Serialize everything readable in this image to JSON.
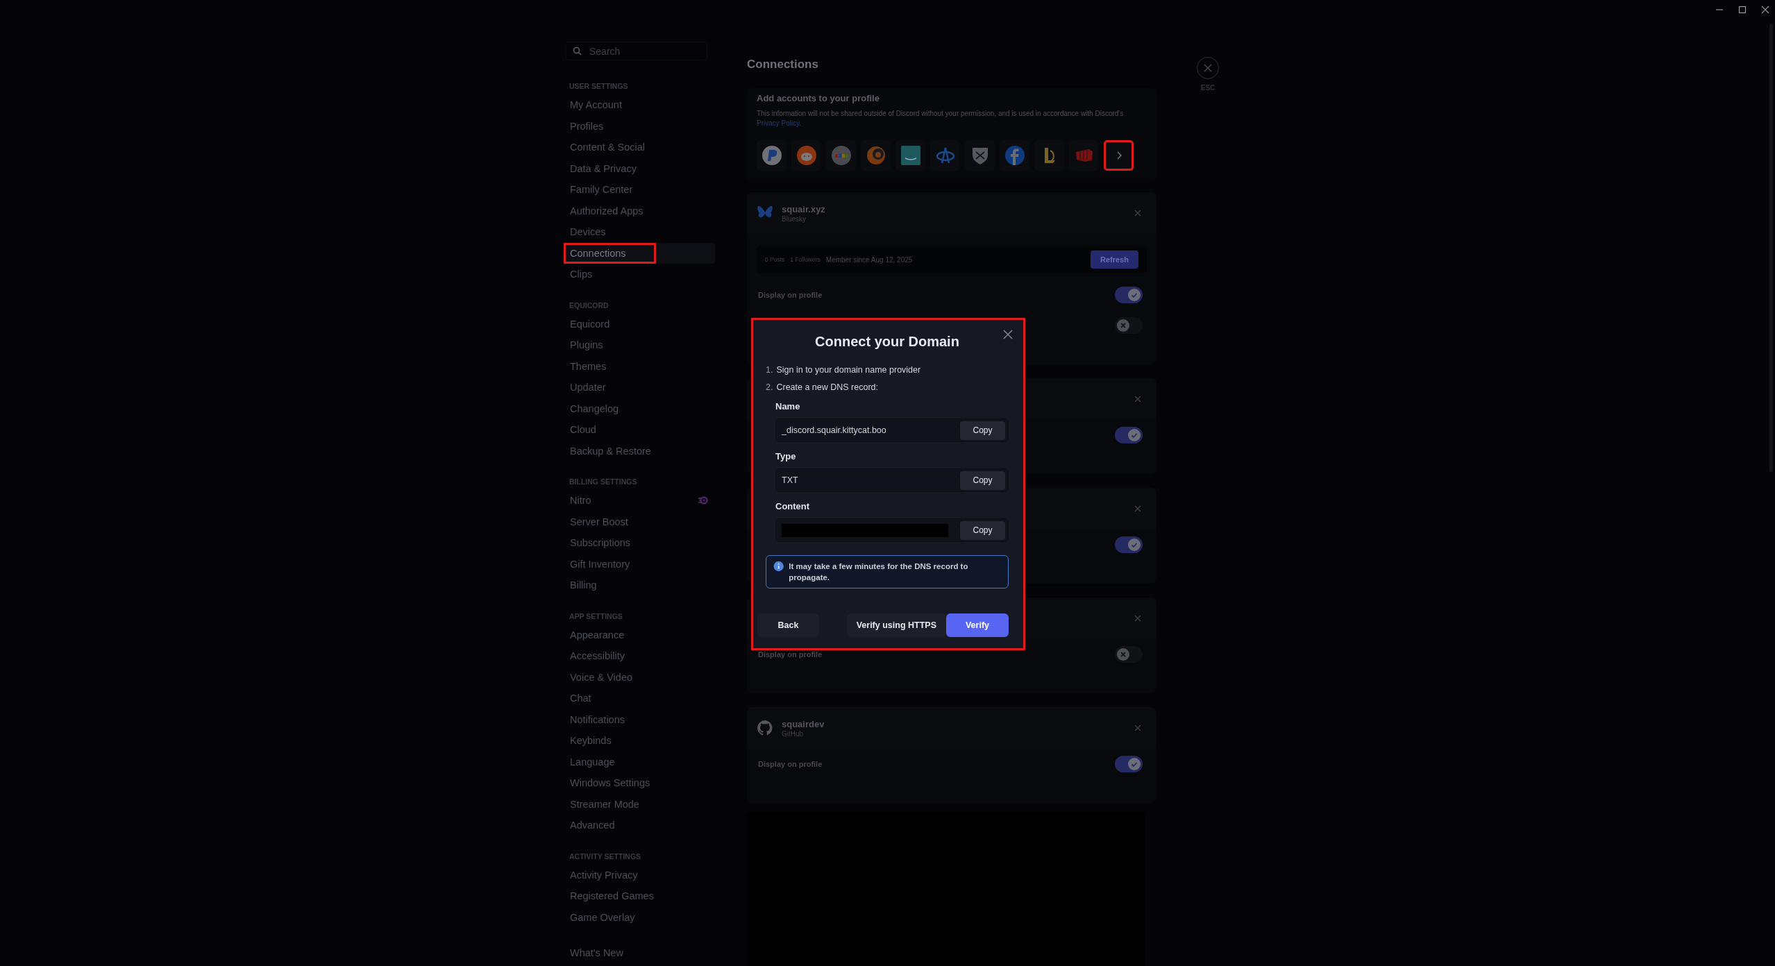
{
  "sidebar": {
    "search": {
      "placeholder": "Search"
    },
    "sections": [
      {
        "heading": "USER SETTINGS",
        "items": [
          {
            "label": "My Account",
            "selected": false,
            "highlighted": false
          },
          {
            "label": "Profiles",
            "selected": false,
            "highlighted": false
          },
          {
            "label": "Content & Social",
            "selected": false,
            "highlighted": false
          },
          {
            "label": "Data & Privacy",
            "selected": false,
            "highlighted": false
          },
          {
            "label": "Family Center",
            "selected": false,
            "highlighted": false
          },
          {
            "label": "Authorized Apps",
            "selected": false,
            "highlighted": false
          },
          {
            "label": "Devices",
            "selected": false,
            "highlighted": false
          },
          {
            "label": "Connections",
            "selected": true,
            "highlighted": true
          },
          {
            "label": "Clips",
            "selected": false,
            "highlighted": false
          }
        ]
      },
      {
        "heading": "EQUICORD",
        "items": [
          {
            "label": "Equicord",
            "selected": false,
            "highlighted": false
          },
          {
            "label": "Plugins",
            "selected": false,
            "highlighted": false
          },
          {
            "label": "Themes",
            "selected": false,
            "highlighted": false
          },
          {
            "label": "Updater",
            "selected": false,
            "highlighted": false
          },
          {
            "label": "Changelog",
            "selected": false,
            "highlighted": false
          },
          {
            "label": "Cloud",
            "selected": false,
            "highlighted": false
          },
          {
            "label": "Backup & Restore",
            "selected": false,
            "highlighted": false
          }
        ]
      },
      {
        "heading": "BILLING SETTINGS",
        "items": [
          {
            "label": "Nitro",
            "selected": false,
            "highlighted": false,
            "has_icon": true
          },
          {
            "label": "Server Boost",
            "selected": false,
            "highlighted": false
          },
          {
            "label": "Subscriptions",
            "selected": false,
            "highlighted": false
          },
          {
            "label": "Gift Inventory",
            "selected": false,
            "highlighted": false
          },
          {
            "label": "Billing",
            "selected": false,
            "highlighted": false
          }
        ]
      },
      {
        "heading": "APP SETTINGS",
        "items": [
          {
            "label": "Appearance",
            "selected": false,
            "highlighted": false
          },
          {
            "label": "Accessibility",
            "selected": false,
            "highlighted": false
          },
          {
            "label": "Voice & Video",
            "selected": false,
            "highlighted": false
          },
          {
            "label": "Chat",
            "selected": false,
            "highlighted": false
          },
          {
            "label": "Notifications",
            "selected": false,
            "highlighted": false
          },
          {
            "label": "Keybinds",
            "selected": false,
            "highlighted": false
          },
          {
            "label": "Language",
            "selected": false,
            "highlighted": false
          },
          {
            "label": "Windows Settings",
            "selected": false,
            "highlighted": false
          },
          {
            "label": "Streamer Mode",
            "selected": false,
            "highlighted": false
          },
          {
            "label": "Advanced",
            "selected": false,
            "highlighted": false
          }
        ]
      },
      {
        "heading": "ACTIVITY SETTINGS",
        "items": [
          {
            "label": "Activity Privacy",
            "selected": false,
            "highlighted": false
          },
          {
            "label": "Registered Games",
            "selected": false,
            "highlighted": false
          },
          {
            "label": "Game Overlay",
            "selected": false,
            "highlighted": false
          }
        ]
      },
      {
        "items": [
          {
            "label": "What's New",
            "selected": false,
            "highlighted": false
          }
        ]
      }
    ]
  },
  "close_button": {
    "label": "ESC"
  },
  "page": {
    "title": "Connections",
    "add_accounts": {
      "title": "Add accounts to your profile",
      "description": "This information will not be shared outside of Discord without your permission, and is used in accordance with Discord's",
      "link": "Privacy Policy",
      "link_suffix": ".",
      "services": [
        {
          "kind": "paypal"
        },
        {
          "kind": "reddit"
        },
        {
          "kind": "ebay"
        },
        {
          "kind": "crunchyroll"
        },
        {
          "kind": "amazon-music"
        },
        {
          "kind": "battlenet"
        },
        {
          "kind": "bungie"
        },
        {
          "kind": "facebook"
        },
        {
          "kind": "league"
        },
        {
          "kind": "riot"
        }
      ],
      "more": {
        "highlighted": true
      }
    },
    "connections": [
      {
        "kind": "bluesky",
        "name": "squair.xyz",
        "service": "Bluesky",
        "stats": {
          "posts": "0 Posts",
          "followers": "1 Followers",
          "member_since": "Member since Aug 12, 2025",
          "button": "Refresh"
        },
        "toggles": [
          {
            "label": "Display on profile",
            "on": true
          },
          {
            "on": false
          }
        ]
      },
      {
        "toggles": [
          {
            "on": true
          }
        ]
      },
      {
        "toggles": [
          {
            "on": true
          }
        ]
      },
      {
        "toggles": [
          {
            "label": "Display on profile",
            "on": false
          }
        ]
      },
      {
        "kind": "github",
        "name": "squairdev",
        "service": "GitHub",
        "toggles": [
          {
            "label": "Display on profile",
            "on": true
          }
        ]
      }
    ]
  },
  "modal": {
    "title": "Connect your Domain",
    "highlighted": true,
    "steps": [
      {
        "number": "1.",
        "text": "Sign in to your domain name provider"
      },
      {
        "number": "2.",
        "text": "Create a new DNS record:"
      }
    ],
    "fields": [
      {
        "label": "Name",
        "value": "_discord.squair.kittycat.boo",
        "redacted": false,
        "copy": "Copy"
      },
      {
        "label": "Type",
        "value": "TXT",
        "redacted": false,
        "copy": "Copy"
      },
      {
        "label": "Content",
        "redacted": true,
        "copy": "Copy"
      }
    ],
    "notice": "It may take a few minutes for the DNS record to propagate.",
    "buttons": [
      {
        "label": "Back",
        "kind": "secondary"
      },
      {
        "label": "Verify using HTTPS",
        "kind": "secondary"
      },
      {
        "label": "Verify",
        "kind": "primary"
      }
    ]
  }
}
